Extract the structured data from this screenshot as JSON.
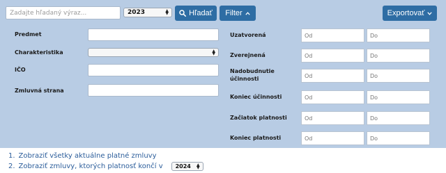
{
  "search": {
    "placeholder": "Zadajte hľadaný výraz...",
    "year_selected": "2023",
    "search_button": "Hľadať",
    "filter_button": "Filter",
    "export_button": "Exportovať"
  },
  "filters_left": {
    "subject_label": "Predmet",
    "characteristic_label": "Charakteristika",
    "ico_label": "IČO",
    "party_label": "Zmluvná strana"
  },
  "filters_right": {
    "rows": [
      {
        "label": "Uzatvorená",
        "from": "Od",
        "to": "Do"
      },
      {
        "label": "Zverejnená",
        "from": "Od",
        "to": "Do"
      },
      {
        "label": "Nadobudnutie účinnosti",
        "from": "Od",
        "to": "Do"
      },
      {
        "label": "Koniec účinnosti",
        "from": "Od",
        "to": "Do"
      },
      {
        "label": "Začiatok platnosti",
        "from": "Od",
        "to": "Do"
      },
      {
        "label": "Koniec platnosti",
        "from": "Od",
        "to": "Do"
      }
    ]
  },
  "links": {
    "item1_number": "1.",
    "item1_text": "Zobraziť všetky aktuálne platné zmluvy",
    "item2_number": "2.",
    "item2_text": "Zobraziť zmluvy, ktorých platnosť končí v",
    "item2_year": "2024"
  },
  "colors": {
    "panel_bg": "#b8cce4",
    "button_bg": "#2e6da4",
    "link": "#2a5c9a"
  }
}
